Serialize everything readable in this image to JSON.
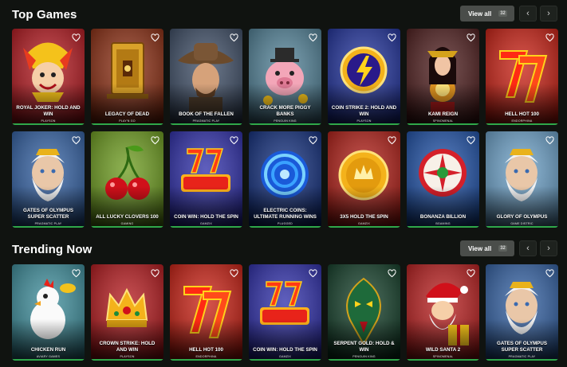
{
  "sections": [
    {
      "title": "Top Games",
      "view_all_label": "View all",
      "view_all_count": "32",
      "prev_glyph": "‹",
      "next_glyph": "›",
      "games": [
        {
          "name": "ROYAL JOKER: HOLD AND WIN",
          "provider": "PLAYSON",
          "theme": "joker",
          "bg": "#b3141b"
        },
        {
          "name": "LEGACY OF DEAD",
          "provider": "PLAY'N GO",
          "theme": "tomb",
          "bg": "#8a2a0e"
        },
        {
          "name": "BOOK OF THE FALLEN",
          "provider": "PRAGMATIC PLAY",
          "theme": "cowboy",
          "bg": "#3a4a63"
        },
        {
          "name": "CRACK MORE PIGGY BANKS",
          "provider": "PENGUIN KING",
          "theme": "pig",
          "bg": "#4e7f95"
        },
        {
          "name": "COIN STRIKE 2: HOLD AND WIN",
          "provider": "PLAYSON",
          "theme": "lightning",
          "bg": "#1c2e9a"
        },
        {
          "name": "KAMI REIGN",
          "provider": "SPINOMENAL",
          "theme": "kami",
          "bg": "#4a1818"
        },
        {
          "name": "HELL HOT 100",
          "provider": "ENDORPHINA",
          "theme": "sevens",
          "bg": "#c81b0e"
        }
      ]
    },
    {
      "games": [
        {
          "name": "GATES OF OLYMPUS SUPER SCATTER",
          "provider": "PRAGMATIC PLAY",
          "theme": "zeus",
          "bg": "#2f5ea2"
        },
        {
          "name": "ALL LUCKY CLOVERS 100",
          "provider": "GAMING",
          "theme": "cherry",
          "bg": "#6a9a1a"
        },
        {
          "name": "COIN WIN: HOLD THE SPIN",
          "provider": "GAMZIX",
          "theme": "wild",
          "bg": "#2a2aa8"
        },
        {
          "name": "ELECTRIC COINS: ULTIMATE RUNNING WINS",
          "provider": "PLUGGED",
          "theme": "vortex",
          "bg": "#0d2a7a"
        },
        {
          "name": "3X5 HOLD THE SPIN",
          "provider": "GAMZIX",
          "theme": "goldcoin",
          "bg": "#b01a12"
        },
        {
          "name": "BONANZA BILLION",
          "provider": "BGAMING",
          "theme": "candy",
          "bg": "#1b4ea6"
        },
        {
          "name": "GLORY OF OLYMPUS",
          "provider": "GAME DISTRIC",
          "theme": "zeus2",
          "bg": "#6aa0c8"
        }
      ]
    },
    {
      "title": "Trending Now",
      "view_all_label": "View all",
      "view_all_count": "32",
      "prev_glyph": "‹",
      "next_glyph": "›",
      "games": [
        {
          "name": "CHICKEN RUN",
          "provider": "AVIARY GAMES",
          "theme": "chicken",
          "bg": "#3a8c9a"
        },
        {
          "name": "CROWN STRIKE: HOLD AND WIN",
          "provider": "PLAYSON",
          "theme": "crown",
          "bg": "#b31418"
        },
        {
          "name": "HELL HOT 100",
          "provider": "ENDORPHINA",
          "theme": "sevens",
          "bg": "#c81b0e"
        },
        {
          "name": "COIN WIN: HOLD THE SPIN",
          "provider": "GAMZIX",
          "theme": "wild",
          "bg": "#2a2aa8"
        },
        {
          "name": "SERPENT GOLD: HOLD & WIN",
          "provider": "PENGUIN KING",
          "theme": "snake",
          "bg": "#0e3a24"
        },
        {
          "name": "WILD SANTA 2",
          "provider": "SPINOMENAL",
          "theme": "santa",
          "bg": "#b81a1a"
        },
        {
          "name": "GATES OF OLYMPUS SUPER SCATTER",
          "provider": "PRAGMATIC PLAY",
          "theme": "zeus",
          "bg": "#2f5ea2"
        }
      ]
    }
  ],
  "icons": {
    "favorite": "heart-outline-icon",
    "prev": "chevron-left-icon",
    "next": "chevron-right-icon"
  }
}
